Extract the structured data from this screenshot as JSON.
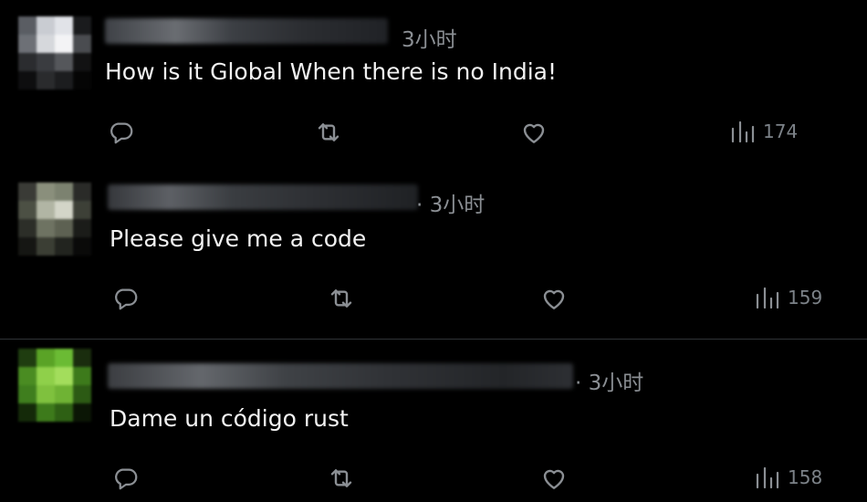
{
  "replies": [
    {
      "time": "3小时",
      "text": "How is it Global When there is no India!",
      "views": "174",
      "icons": [
        "reply-icon",
        "retweet-icon",
        "like-icon",
        "views-icon"
      ]
    },
    {
      "time": "· 3小时",
      "text": "Please give me a code",
      "views": "159",
      "icons": [
        "reply-icon",
        "retweet-icon",
        "like-icon",
        "views-icon"
      ]
    },
    {
      "time": "· 3小时",
      "text": "Dame un código rust",
      "views": "158",
      "icons": [
        "reply-icon",
        "retweet-icon",
        "like-icon",
        "views-icon"
      ]
    }
  ],
  "colors": {
    "background": "#000000",
    "text": "#f2f2f2",
    "muted": "#8b8f94",
    "divider": "#2f3336"
  }
}
